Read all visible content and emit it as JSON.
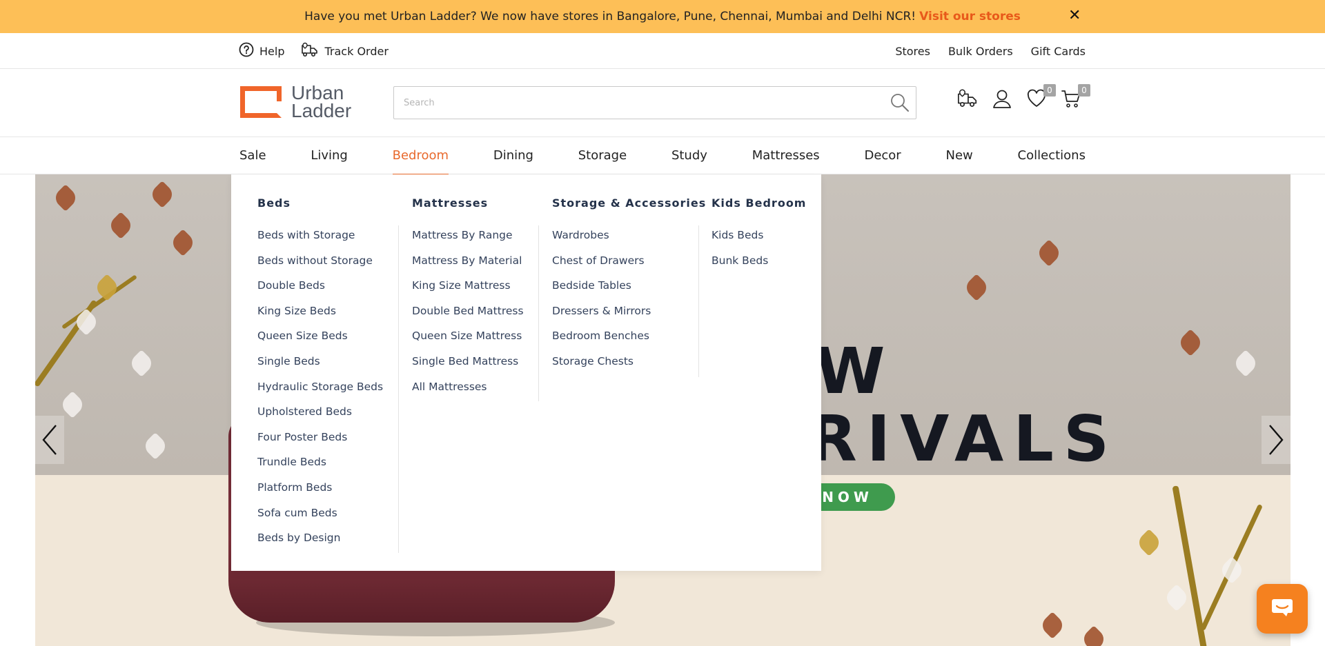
{
  "announcement": {
    "message": "Have you met Urban Ladder? We now have stores in Bangalore, Pune, Chennai, Mumbai and Delhi NCR!",
    "link": "Visit our stores",
    "close_glyph": "✕"
  },
  "utility_bar": {
    "help_label": "Help",
    "track_order_label": "Track Order",
    "right_links": [
      "Stores",
      "Bulk Orders",
      "Gift Cards"
    ]
  },
  "header": {
    "logo_line1": "Urban",
    "logo_line2": "Ladder",
    "search_placeholder": "Search",
    "wishlist_count": "0",
    "cart_count": "0",
    "icons": [
      "delivery-truck-icon",
      "user-icon",
      "heart-icon",
      "cart-icon"
    ]
  },
  "main_nav": {
    "items": [
      "Sale",
      "Living",
      "Bedroom",
      "Dining",
      "Storage",
      "Study",
      "Mattresses",
      "Decor",
      "New",
      "Collections"
    ],
    "active": "Bedroom"
  },
  "mega_menu": {
    "columns": [
      {
        "heading": "Beds",
        "items": [
          "Beds with Storage",
          "Beds without Storage",
          "Double Beds",
          "King Size Beds",
          "Queen Size Beds",
          "Single Beds",
          "Hydraulic Storage Beds",
          "Upholstered Beds",
          "Four Poster Beds",
          "Trundle Beds",
          "Platform Beds",
          "Sofa cum Beds",
          "Beds by Design"
        ]
      },
      {
        "heading": "Mattresses",
        "items": [
          "Mattress By Range",
          "Mattress By Material",
          "King Size Mattress",
          "Double Bed Mattress",
          "Queen Size Mattress",
          "Single Bed Mattress",
          "All Mattresses"
        ]
      },
      {
        "heading": "Storage & Accessories",
        "items": [
          "Wardrobes",
          "Chest of Drawers",
          "Bedside Tables",
          "Dressers & Mirrors",
          "Bedroom Benches",
          "Storage Chests"
        ]
      },
      {
        "heading": "Kids Bedroom",
        "items": [
          "Kids Beds",
          "Bunk Beds"
        ]
      }
    ]
  },
  "banner": {
    "line1_fragment": "W",
    "line2_fragment": "RIVALS",
    "cta_fragment": "NOW",
    "colors": {
      "cta": "#3f9b4e",
      "text": "#151821",
      "accent": "#e8692c"
    }
  }
}
